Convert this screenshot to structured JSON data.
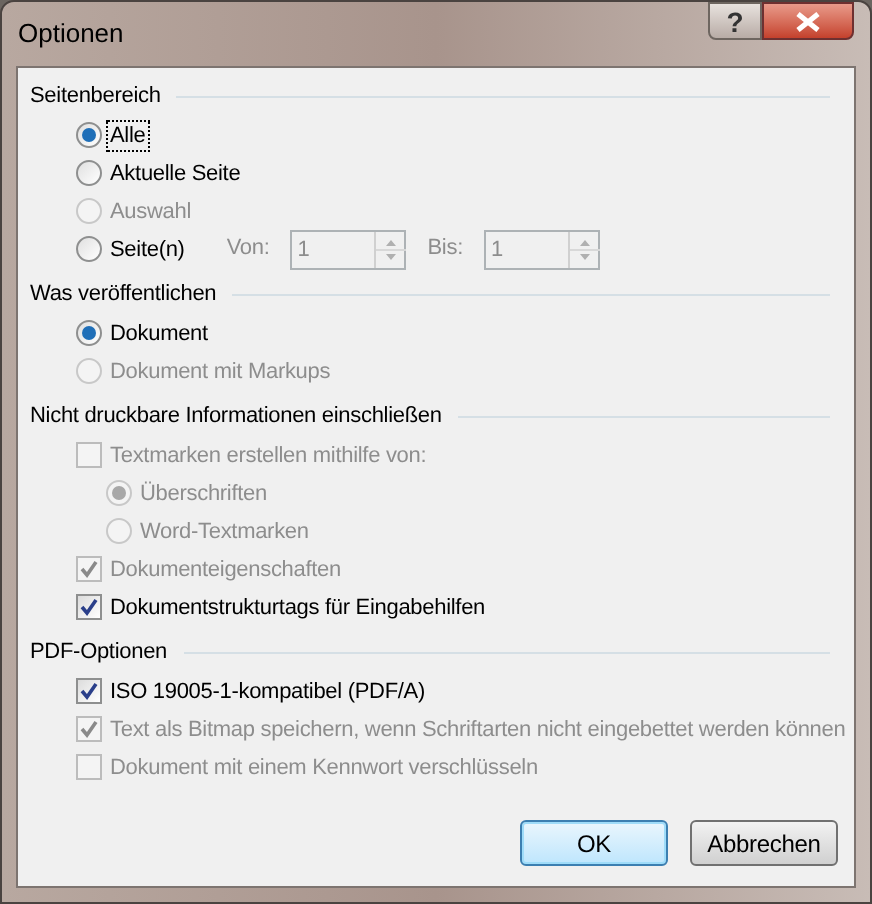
{
  "window": {
    "title": "Optionen",
    "buttons": [
      {
        "kind": "help",
        "label": "?"
      },
      {
        "kind": "close"
      }
    ]
  },
  "sections": [
    {
      "title": "Seitenbereich",
      "items": [
        {
          "kind": "radio",
          "label": "Alle",
          "selected": true,
          "disabled": false,
          "focused": true
        },
        {
          "kind": "radio",
          "label": "Aktuelle Seite",
          "selected": false,
          "disabled": false,
          "focused": false
        },
        {
          "kind": "radio",
          "label": "Auswahl",
          "selected": false,
          "disabled": true,
          "focused": false
        },
        {
          "kind": "radio",
          "label": "Seite(n)",
          "selected": false,
          "disabled": false,
          "focused": false,
          "spinners": [
            {
              "label": "Von:",
              "value": "1",
              "disabled": true
            },
            {
              "label": "Bis:",
              "value": "1",
              "disabled": true
            }
          ]
        }
      ]
    },
    {
      "title": "Was veröffentlichen",
      "items": [
        {
          "kind": "radio",
          "label": "Dokument",
          "selected": true,
          "disabled": false,
          "focused": false
        },
        {
          "kind": "radio",
          "label": "Dokument mit Markups",
          "selected": false,
          "disabled": true,
          "focused": false
        }
      ]
    },
    {
      "title": "Nicht druckbare Informationen einschließen",
      "items": [
        {
          "kind": "checkbox",
          "label": "Textmarken erstellen mithilfe von:",
          "checked": false,
          "disabled": true,
          "focused": false,
          "children": [
            {
              "kind": "radio",
              "label": "Überschriften",
              "selected": true,
              "disabled": true,
              "focused": false
            },
            {
              "kind": "radio",
              "label": "Word-Textmarken",
              "selected": false,
              "disabled": true,
              "focused": false
            }
          ]
        },
        {
          "kind": "checkbox",
          "label": "Dokumenteigenschaften",
          "checked": true,
          "disabled": true,
          "focused": false
        },
        {
          "kind": "checkbox",
          "label": "Dokumentstrukturtags für Eingabehilfen",
          "checked": true,
          "disabled": false,
          "focused": false
        }
      ]
    },
    {
      "title": "PDF-Optionen",
      "items": [
        {
          "kind": "checkbox",
          "label": "ISO 19005-1-kompatibel (PDF/A)",
          "checked": true,
          "disabled": false,
          "focused": false
        },
        {
          "kind": "checkbox",
          "label": "Text als Bitmap speichern, wenn Schriftarten nicht eingebettet werden können",
          "checked": true,
          "disabled": true,
          "focused": false
        },
        {
          "kind": "checkbox",
          "label": "Dokument mit einem Kennwort verschlüsseln",
          "checked": false,
          "disabled": true,
          "focused": false
        }
      ]
    }
  ],
  "footer_buttons": [
    {
      "label": "OK",
      "default": true
    },
    {
      "label": "Abbrechen",
      "default": false
    }
  ]
}
